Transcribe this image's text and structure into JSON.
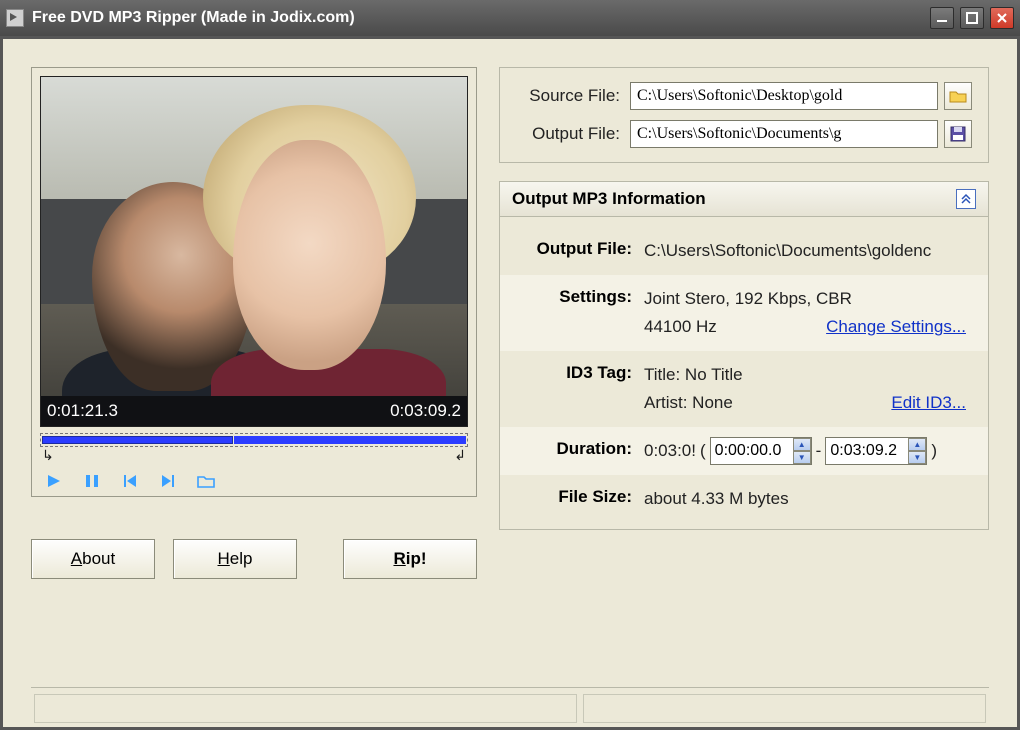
{
  "window": {
    "title": "Free DVD MP3 Ripper   (Made in Jodix.com)"
  },
  "files": {
    "source_label": "Source File:",
    "source_value": "C:\\Users\\Softonic\\Desktop\\gold",
    "output_label": "Output File:",
    "output_value": "C:\\Users\\Softonic\\Documents\\g"
  },
  "preview": {
    "current_time": "0:01:21.3",
    "total_time": "0:03:09.2",
    "start_marker": "⤷",
    "end_marker": "⤶"
  },
  "buttons": {
    "about": "About",
    "help": "Help",
    "rip": "Rip!"
  },
  "panel": {
    "title": "Output MP3 Information"
  },
  "info": {
    "output_file_label": "Output File:",
    "output_file_value": "C:\\Users\\Softonic\\Documents\\goldenc",
    "settings_label": "Settings:",
    "settings_line1": "Joint Stero, 192 Kbps, CBR",
    "settings_line2": "44100 Hz",
    "settings_link": "Change Settings...",
    "id3_label": "ID3 Tag:",
    "id3_line1": "Title: No Title",
    "id3_line2": "Artist: None",
    "id3_link": "Edit ID3...",
    "duration_label": "Duration:",
    "duration_total": "0:03:0!",
    "duration_from": "0:00:00.0",
    "duration_to": "0:03:09.2",
    "filesize_label": "File Size:",
    "filesize_value": "about 4.33 M bytes"
  }
}
